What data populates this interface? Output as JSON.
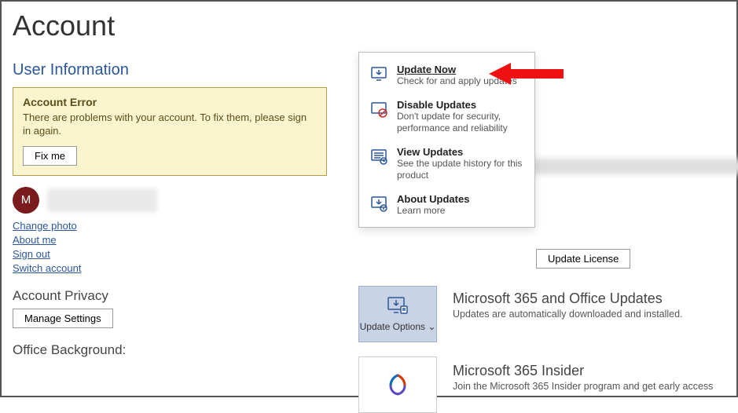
{
  "title": "Account",
  "left": {
    "userInfoHead": "User Information",
    "error": {
      "title": "Account Error",
      "text": "There are problems with your account. To fix them, please sign in again.",
      "button": "Fix me"
    },
    "avatarInitial": "M",
    "links": {
      "changePhoto": "Change photo",
      "aboutMe": "About me",
      "signOut": "Sign out",
      "switchAccount": "Switch account"
    },
    "accountPrivacyHead": "Account Privacy",
    "manageSettings": "Manage Settings",
    "officeBackgroundHead": "Office Background:"
  },
  "menu": {
    "updateNow": {
      "title": "Update Now",
      "desc": "Check for and apply updates"
    },
    "disable": {
      "title": "Disable Updates",
      "desc": "Don't update for security, performance and reliability"
    },
    "view": {
      "title": "View Updates",
      "desc": "See the update history for this product"
    },
    "about": {
      "title": "About Updates",
      "desc": "Learn more"
    }
  },
  "right": {
    "updateLicense": "Update License",
    "updateOptions": "Update Options ⌄",
    "updatesBlock": {
      "title": "Microsoft 365 and Office Updates",
      "desc": "Updates are automatically downloaded and installed."
    },
    "insiderBlock": {
      "title": "Microsoft 365 Insider",
      "desc": "Join the Microsoft 365 Insider program and get early access"
    }
  }
}
